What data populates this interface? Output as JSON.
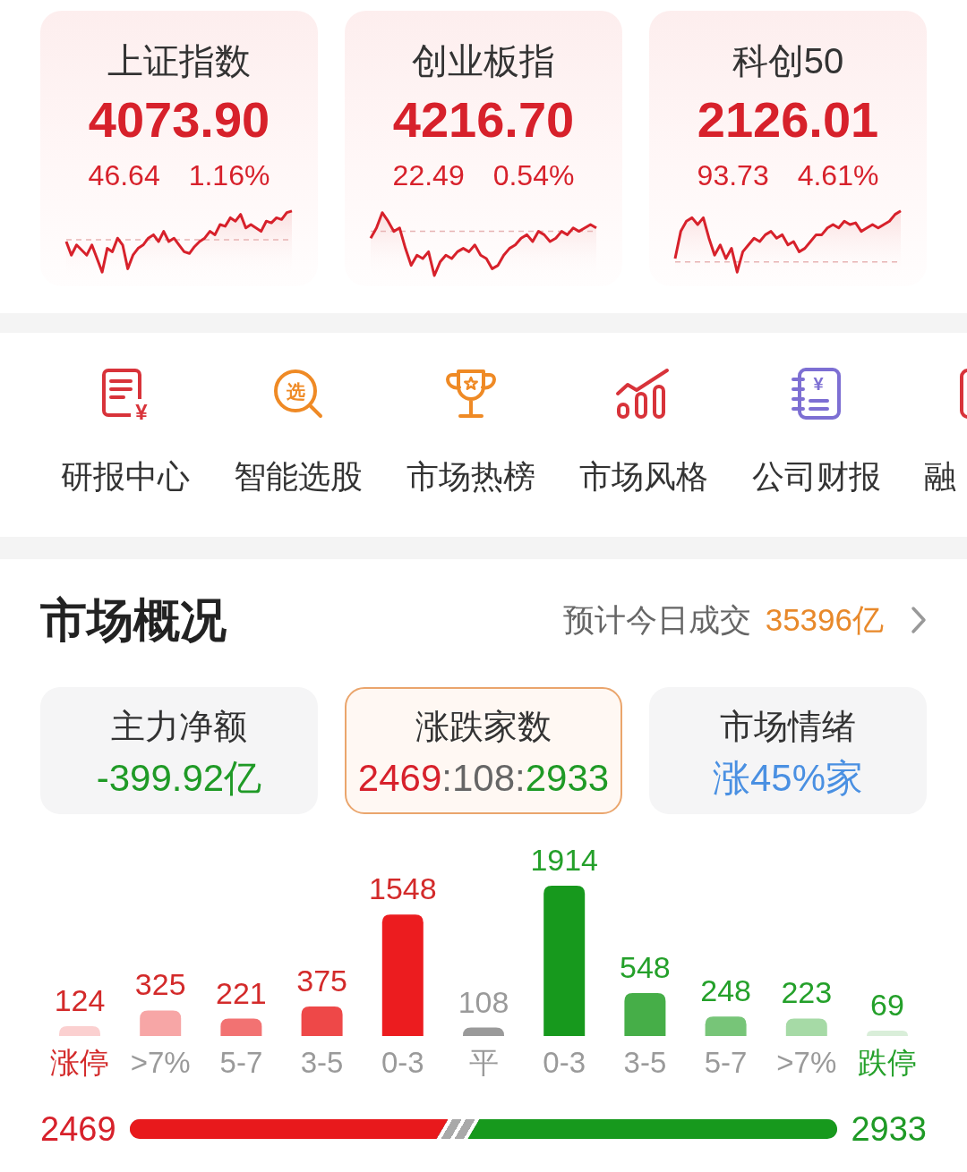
{
  "index_cards": [
    {
      "name": "上证指数",
      "value": "4073.90",
      "change": "46.64",
      "change_pct": "1.16%"
    },
    {
      "name": "创业板指",
      "value": "4216.70",
      "change": "22.49",
      "change_pct": "0.54%"
    },
    {
      "name": "科创50",
      "value": "2126.01",
      "change": "93.73",
      "change_pct": "4.61%"
    }
  ],
  "shortcuts": [
    {
      "kind": "report",
      "label": "研报中心",
      "icon_text": "¥"
    },
    {
      "kind": "pick",
      "label": "智能选股",
      "icon_text": "选"
    },
    {
      "kind": "trophy",
      "label": "市场热榜"
    },
    {
      "kind": "trend",
      "label": "市场风格"
    },
    {
      "kind": "ledger",
      "label": "公司财报",
      "icon_text": "¥"
    },
    {
      "kind": "clipped",
      "label": "融"
    }
  ],
  "market_overview": {
    "title": "市场概况",
    "turnover_label": "预计今日成交",
    "turnover_value": "35396亿",
    "stat_cards": [
      {
        "title": "主力净额",
        "selected": false,
        "value_parts": [
          {
            "text": "-399.92亿",
            "color": "#1f9a26"
          }
        ]
      },
      {
        "title": "涨跌家数",
        "selected": true,
        "value_parts": [
          {
            "text": "2469",
            "color": "#d7212b"
          },
          {
            "text": ":108:",
            "color": "#666666"
          },
          {
            "text": "2933",
            "color": "#1f9a26"
          }
        ]
      },
      {
        "title": "市场情绪",
        "selected": false,
        "value_parts": [
          {
            "text": "涨45%家",
            "color": "#4a90e2"
          }
        ]
      }
    ],
    "distribution": {
      "chart_data": {
        "type": "bar",
        "categories": [
          "涨停",
          ">7%",
          "5-7",
          "3-5",
          "0-3",
          "平",
          "0-3",
          "3-5",
          "5-7",
          ">7%",
          "跌停"
        ],
        "values": [
          124,
          325,
          221,
          375,
          1548,
          108,
          1914,
          548,
          248,
          223,
          69
        ],
        "colors": [
          "#fbd0d0",
          "#f7a6a6",
          "#f27272",
          "#ee4848",
          "#ec1c1f",
          "#9a9a9a",
          "#17991d",
          "#46ae48",
          "#77c578",
          "#a6daa6",
          "#d9eed9"
        ],
        "data_labels": true
      }
    },
    "ratio_bar": {
      "rise_count": "2469",
      "fall_count": "2933",
      "level": 0.45
    }
  }
}
